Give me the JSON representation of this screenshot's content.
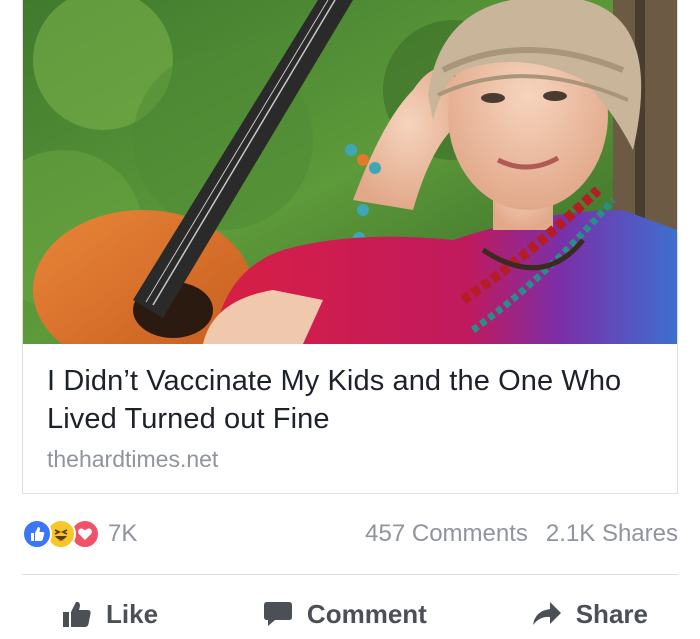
{
  "link": {
    "title": "I Didn’t Vaccinate My Kids and the One Who Lived Turned out Fine",
    "domain": "thehardtimes.net",
    "image_description": "woman-with-guitar"
  },
  "counts": {
    "reactions_total": "7K",
    "comments": "457 Comments",
    "shares": "2.1K Shares",
    "reaction_icons": [
      "like",
      "haha",
      "love"
    ]
  },
  "actions": {
    "like_label": "Like",
    "comment_label": "Comment",
    "share_label": "Share"
  },
  "colors": {
    "like_blue": "#3b76f7",
    "haha_yellow": "#f7c627",
    "love_red": "#f25268",
    "meta_gray": "#90949c",
    "action_gray": "#4b4f56"
  }
}
